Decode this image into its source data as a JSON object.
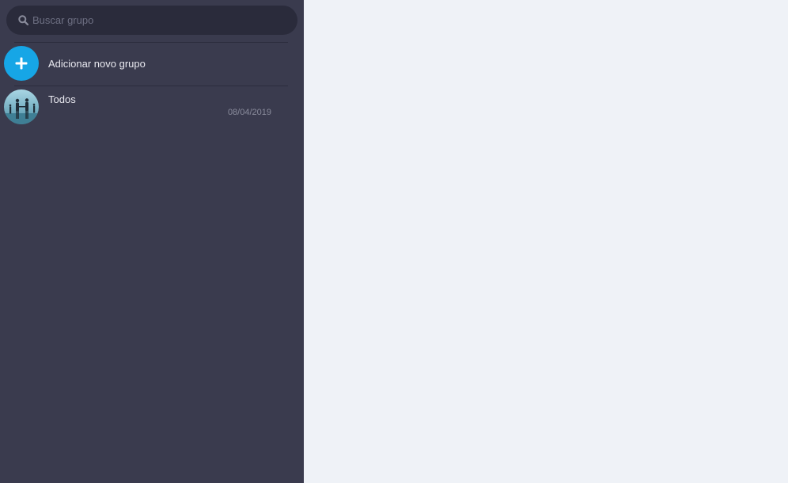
{
  "search": {
    "placeholder": "Buscar grupo",
    "value": ""
  },
  "add_group": {
    "label": "Adicionar novo grupo",
    "icon": "plus-icon"
  },
  "groups": [
    {
      "name": "Todos",
      "date": "08/04/2019",
      "avatar": "group-avatar"
    }
  ],
  "colors": {
    "sidebar_bg": "#3a3b4e",
    "search_bg": "#2a2b3b",
    "main_bg": "#eff2f7",
    "accent": "#16a6e6"
  }
}
